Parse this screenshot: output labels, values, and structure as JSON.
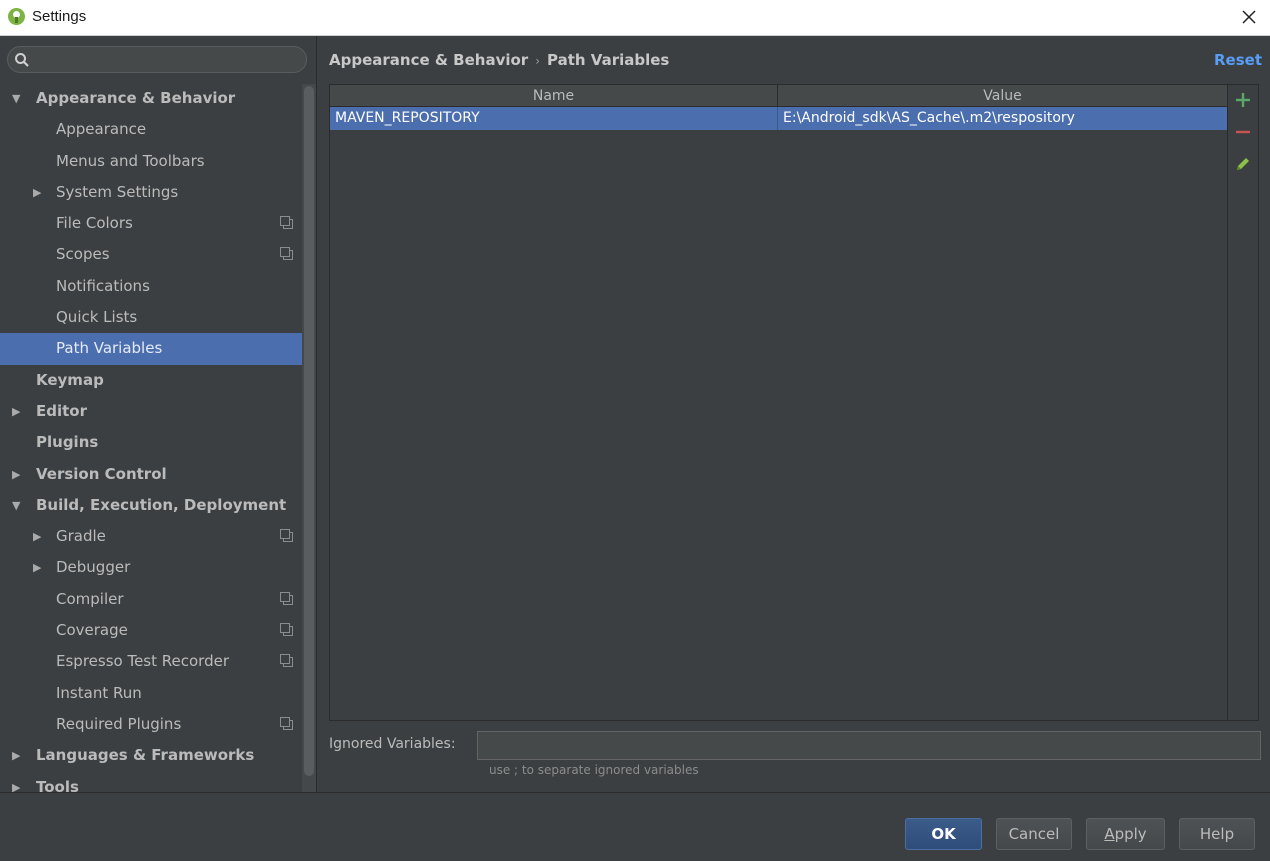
{
  "window": {
    "title": "Settings"
  },
  "search": {
    "placeholder": "",
    "value": ""
  },
  "tree": [
    {
      "label": "Appearance & Behavior",
      "level": 0,
      "bold": true,
      "arrow": "expanded",
      "project": false,
      "selected": false
    },
    {
      "label": "Appearance",
      "level": 1,
      "bold": false,
      "arrow": "none",
      "project": false,
      "selected": false
    },
    {
      "label": "Menus and Toolbars",
      "level": 1,
      "bold": false,
      "arrow": "none",
      "project": false,
      "selected": false
    },
    {
      "label": "System Settings",
      "level": 1,
      "bold": false,
      "arrow": "collapsed",
      "project": false,
      "selected": false
    },
    {
      "label": "File Colors",
      "level": 1,
      "bold": false,
      "arrow": "none",
      "project": true,
      "selected": false
    },
    {
      "label": "Scopes",
      "level": 1,
      "bold": false,
      "arrow": "none",
      "project": true,
      "selected": false
    },
    {
      "label": "Notifications",
      "level": 1,
      "bold": false,
      "arrow": "none",
      "project": false,
      "selected": false
    },
    {
      "label": "Quick Lists",
      "level": 1,
      "bold": false,
      "arrow": "none",
      "project": false,
      "selected": false
    },
    {
      "label": "Path Variables",
      "level": 1,
      "bold": false,
      "arrow": "none",
      "project": false,
      "selected": true
    },
    {
      "label": "Keymap",
      "level": 0,
      "bold": true,
      "arrow": "none",
      "project": false,
      "selected": false
    },
    {
      "label": "Editor",
      "level": 0,
      "bold": true,
      "arrow": "collapsed",
      "project": false,
      "selected": false
    },
    {
      "label": "Plugins",
      "level": 0,
      "bold": true,
      "arrow": "none",
      "project": false,
      "selected": false
    },
    {
      "label": "Version Control",
      "level": 0,
      "bold": true,
      "arrow": "collapsed",
      "project": false,
      "selected": false
    },
    {
      "label": "Build, Execution, Deployment",
      "level": 0,
      "bold": true,
      "arrow": "expanded",
      "project": false,
      "selected": false
    },
    {
      "label": "Gradle",
      "level": 1,
      "bold": false,
      "arrow": "collapsed",
      "project": true,
      "selected": false
    },
    {
      "label": "Debugger",
      "level": 1,
      "bold": false,
      "arrow": "collapsed",
      "project": false,
      "selected": false
    },
    {
      "label": "Compiler",
      "level": 1,
      "bold": false,
      "arrow": "none",
      "project": true,
      "selected": false
    },
    {
      "label": "Coverage",
      "level": 1,
      "bold": false,
      "arrow": "none",
      "project": true,
      "selected": false
    },
    {
      "label": "Espresso Test Recorder",
      "level": 1,
      "bold": false,
      "arrow": "none",
      "project": true,
      "selected": false
    },
    {
      "label": "Instant Run",
      "level": 1,
      "bold": false,
      "arrow": "none",
      "project": false,
      "selected": false
    },
    {
      "label": "Required Plugins",
      "level": 1,
      "bold": false,
      "arrow": "none",
      "project": true,
      "selected": false
    },
    {
      "label": "Languages & Frameworks",
      "level": 0,
      "bold": true,
      "arrow": "collapsed",
      "project": false,
      "selected": false
    },
    {
      "label": "Tools",
      "level": 0,
      "bold": true,
      "arrow": "collapsed",
      "project": false,
      "selected": false
    }
  ],
  "breadcrumb": {
    "parent": "Appearance & Behavior",
    "separator": "›",
    "current": "Path Variables"
  },
  "reset_label": "Reset",
  "table": {
    "headers": {
      "name": "Name",
      "value": "Value"
    },
    "rows": [
      {
        "name": "MAVEN_REPOSITORY",
        "value": "E:\\Android_sdk\\AS_Cache\\.m2\\respository"
      }
    ]
  },
  "toolbar_icons": [
    "add-icon",
    "remove-icon",
    "edit-icon"
  ],
  "ignored": {
    "label": "Ignored Variables:",
    "value": "",
    "hint": "use ; to separate ignored variables"
  },
  "buttons": {
    "ok": "OK",
    "cancel": "Cancel",
    "apply_mnemonic": "A",
    "apply_rest": "pply",
    "help": "Help"
  },
  "colors": {
    "background": "#3c3f41",
    "selection": "#4b6eaf",
    "link": "#589df6",
    "add": "#59a869",
    "remove": "#c75450",
    "edit": "#8bc34a"
  }
}
